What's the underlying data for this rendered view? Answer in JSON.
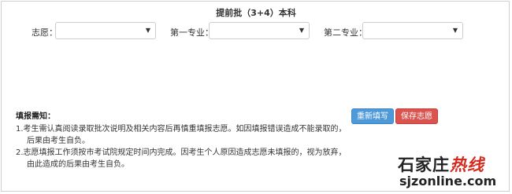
{
  "page": {
    "title": "提前批（3+4）本科"
  },
  "form": {
    "fields": [
      {
        "label": "志愿：",
        "value": ""
      },
      {
        "label": "第一专业：",
        "value": ""
      },
      {
        "label": "第二专业：",
        "value": ""
      }
    ]
  },
  "notice": {
    "title": "填报需知：",
    "lines": [
      "1.考生需认真阅读录取批次说明及相关内容后再慎重填报志愿。如因填报错误造成不能录取的，",
      "后果由考生自负。",
      "2.志愿填报工作须按市考试院规定时间内完成。因考生个人原因造成志愿未填报的，视为放弃，",
      "由此造成的后果由考生自负。"
    ]
  },
  "buttons": {
    "reset_label": "重新填写",
    "save_label": "保存志愿"
  },
  "watermark": {
    "brand_part1": "石家庄",
    "brand_part2": "热线",
    "domain": "sjzonline.com"
  },
  "colors": {
    "reset_button": "#4e9ad9",
    "save_button": "#d9534f",
    "watermark_accent": "#d52b1e"
  }
}
